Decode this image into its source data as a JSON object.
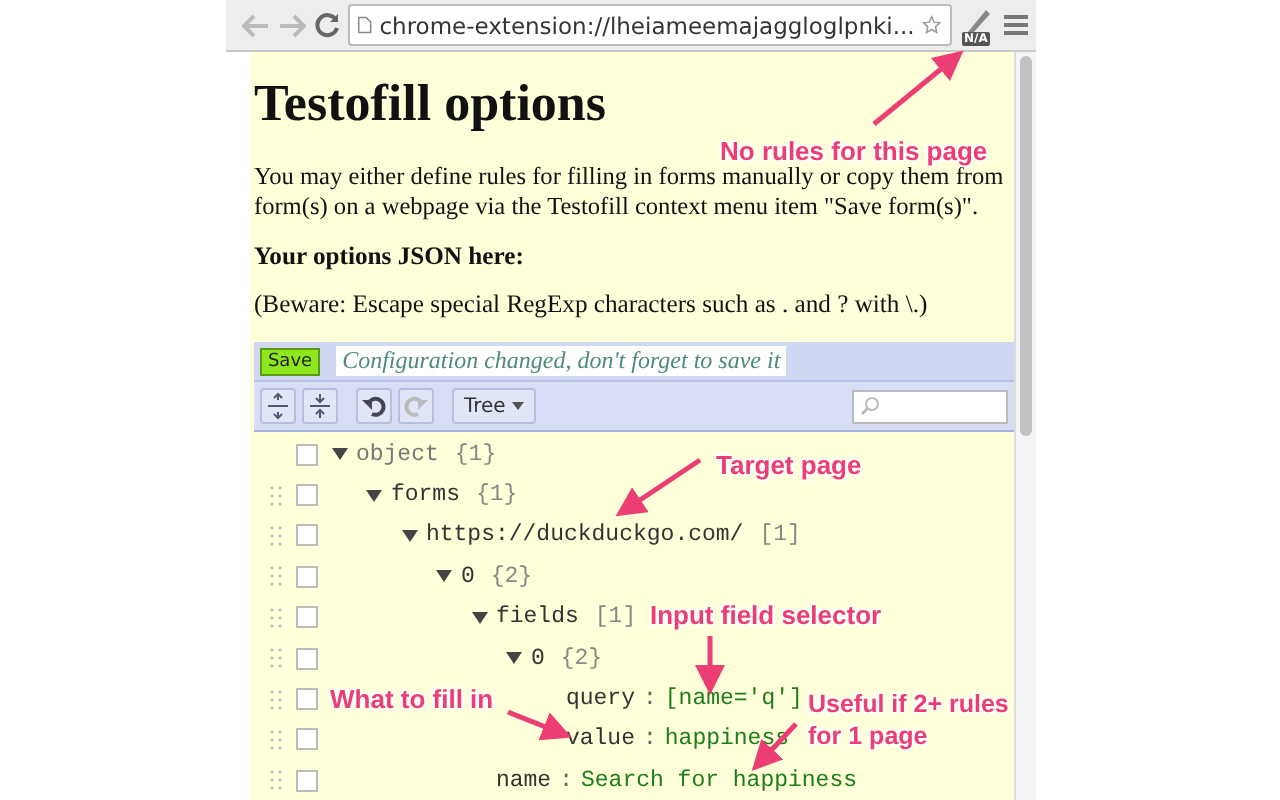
{
  "browser": {
    "address": "chrome-extension://lheiameemajaggloglpnki...",
    "extension_badge": "N/A",
    "bookmarked": false
  },
  "page": {
    "title": "Testofill options",
    "intro": "You may either define rules for filling in forms manually or copy them from form(s) on a webpage via the Testofill context menu item \"Save form(s)\".",
    "json_label": "Your options JSON here:",
    "beware": "(Beware: Escape special RegExp characters such as . and ? with \\.)"
  },
  "editor": {
    "save_button": "Save",
    "message": "Configuration changed, don't forget to save it",
    "tools": [
      {
        "kind": "expand-all"
      },
      {
        "kind": "collapse-all"
      },
      {
        "kind": "undo",
        "disabled": false
      },
      {
        "kind": "redo",
        "disabled": true
      }
    ],
    "mode_button": "Tree",
    "tree": [
      {
        "kind": "root",
        "key": "object",
        "count": "{1}",
        "checked": false,
        "expanded": true,
        "children": [
          {
            "kind": "node",
            "key": "forms",
            "count": "{1}",
            "checked": false,
            "expanded": true,
            "children": [
              {
                "kind": "node",
                "key": "https://duckduckgo.com/",
                "count": "[1]",
                "checked": false,
                "expanded": true,
                "children": [
                  {
                    "kind": "node",
                    "key": "0",
                    "count": "{2}",
                    "checked": false,
                    "expanded": true,
                    "children": [
                      {
                        "kind": "node",
                        "key": "fields",
                        "count": "[1]",
                        "checked": false,
                        "expanded": true,
                        "children": [
                          {
                            "kind": "node",
                            "key": "0",
                            "count": "{2}",
                            "checked": false,
                            "expanded": true,
                            "children": [
                              {
                                "kind": "leaf",
                                "key": "query",
                                "separator": ":",
                                "value": "[name='q']",
                                "checked": false
                              },
                              {
                                "kind": "leaf",
                                "key": "value",
                                "separator": ":",
                                "value": "happiness",
                                "checked": false
                              }
                            ]
                          }
                        ]
                      },
                      {
                        "kind": "leaf",
                        "key": "name",
                        "separator": ":",
                        "value": "Search for happiness",
                        "checked": false
                      }
                    ]
                  }
                ]
              }
            ]
          }
        ]
      }
    ]
  },
  "annotations": [
    {
      "text": "No rules for this page"
    },
    {
      "text": "Target page"
    },
    {
      "text": "Input field selector"
    },
    {
      "text": "What to fill in"
    },
    {
      "text": "Useful if 2+ rules for 1 page"
    }
  ]
}
